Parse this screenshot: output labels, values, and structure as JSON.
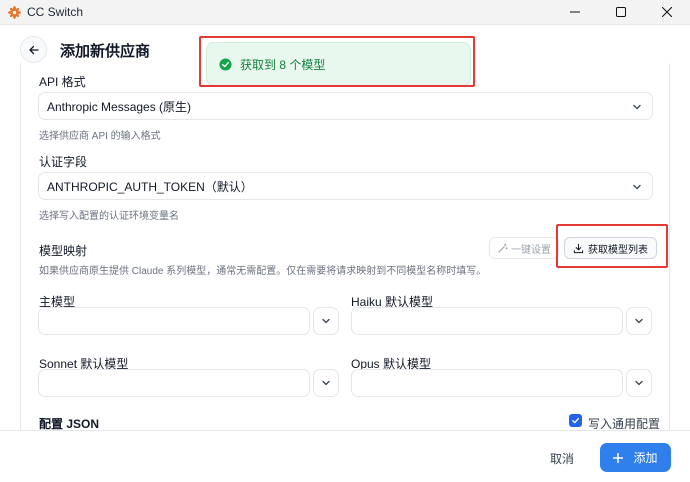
{
  "window": {
    "title": "CC Switch"
  },
  "header": {
    "title": "添加新供应商"
  },
  "api_format": {
    "label": "API 格式",
    "value": "Anthropic Messages (原生)",
    "hint": "选择供应商 API 的输入格式"
  },
  "auth_field": {
    "label": "认证字段",
    "value": "ANTHROPIC_AUTH_TOKEN（默认）",
    "hint": "选择写入配置的认证环境变量名"
  },
  "model_mapping": {
    "label": "模型映射",
    "hint": "如果供应商原生提供 Claude 系列模型，通常无需配置。仅在需要将请求映射到不同模型名称时填写。",
    "auto_label": "一键设置",
    "fetch_label": "获取模型列表",
    "fields": {
      "main": {
        "label": "主模型",
        "value": ""
      },
      "haiku": {
        "label": "Haiku 默认模型",
        "value": ""
      },
      "sonnet": {
        "label": "Sonnet 默认模型",
        "value": ""
      },
      "opus": {
        "label": "Opus 默认模型",
        "value": ""
      }
    }
  },
  "config_json": {
    "label": "配置 JSON",
    "write_common_label": "写入通用配置",
    "write_common_checked": true
  },
  "footer": {
    "cancel_label": "取消",
    "add_label": "添加"
  },
  "toast": {
    "message": "获取到 8 个模型",
    "status": "success"
  },
  "colors": {
    "accent": "#2f80ed",
    "success": "#16a34a",
    "highlight": "#e53935"
  }
}
